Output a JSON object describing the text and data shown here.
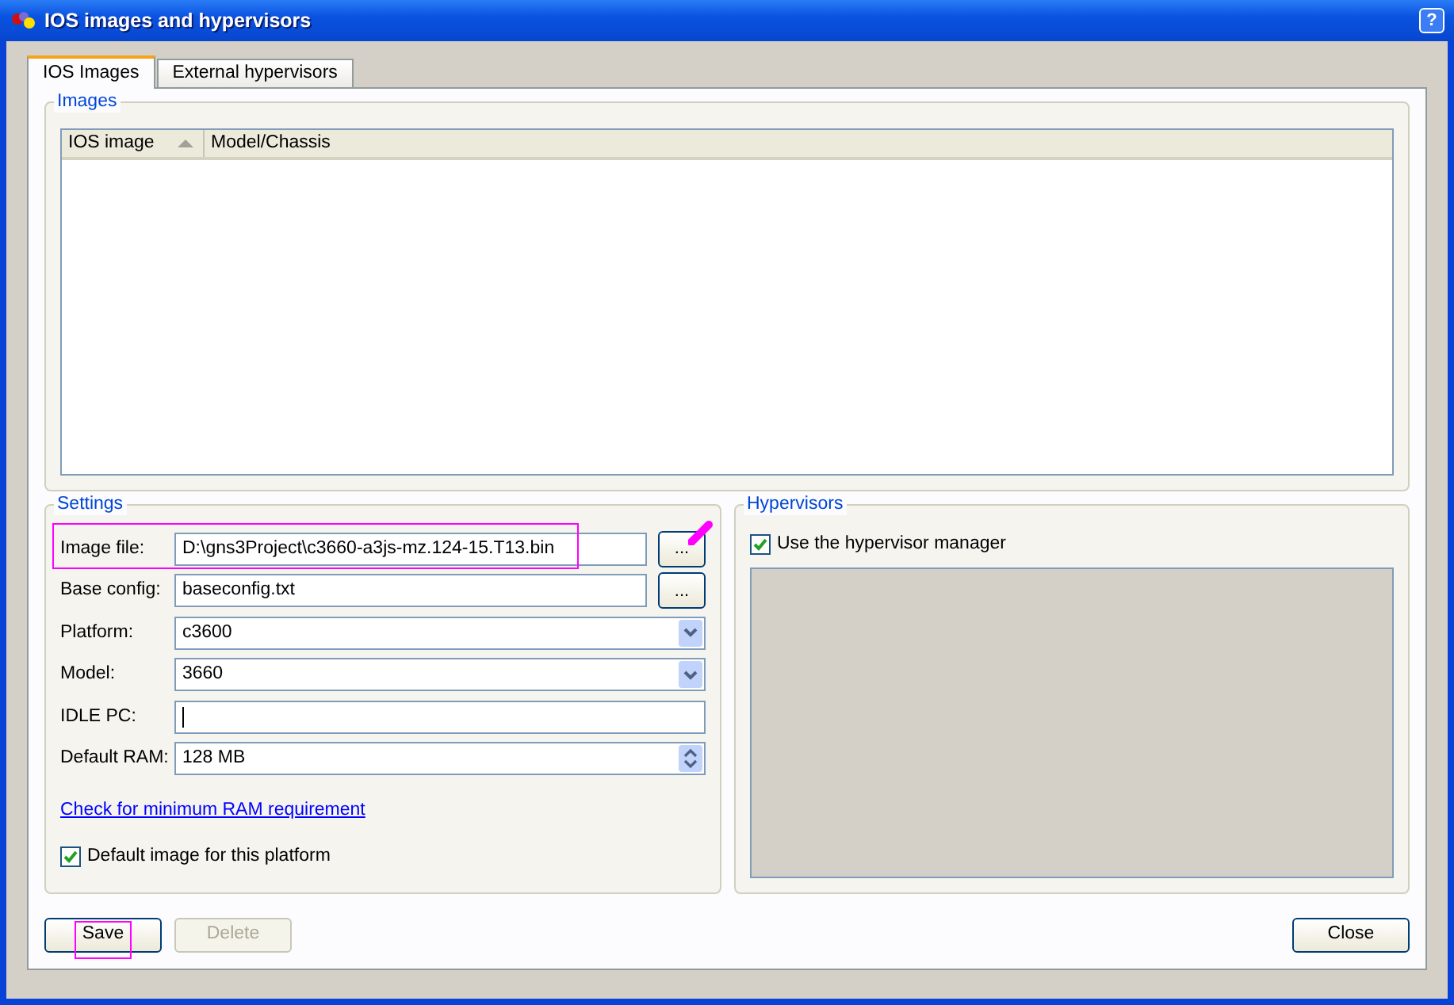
{
  "window": {
    "title": "IOS images and hypervisors",
    "help_button": "?"
  },
  "tabs": [
    {
      "label": "IOS Images",
      "selected": true
    },
    {
      "label": "External hypervisors",
      "selected": false
    }
  ],
  "images": {
    "title": "Images",
    "columns": [
      {
        "label": "IOS image",
        "sorted": true
      },
      {
        "label": "Model/Chassis",
        "sorted": false
      }
    ]
  },
  "settings": {
    "title": "Settings",
    "fields": [
      {
        "kind": "browse",
        "label": "Image file:",
        "value": "D:\\gns3Project\\c3660-a3js-mz.124-15.T13.bin",
        "button": "...",
        "highlighted": true,
        "pen_mark": true
      },
      {
        "kind": "browse",
        "label": "Base config:",
        "value": "baseconfig.txt",
        "button": "...",
        "highlighted": false,
        "pen_mark": false
      },
      {
        "kind": "select",
        "label": "Platform:",
        "value": "c3600"
      },
      {
        "kind": "select",
        "label": "Model:",
        "value": "3660"
      },
      {
        "kind": "text",
        "label": "IDLE PC:",
        "focused": true
      },
      {
        "kind": "spin",
        "label": "Default RAM:",
        "value": "128 MB"
      }
    ],
    "link": "Check for minimum RAM requirement",
    "default_checkbox": {
      "label": "Default image for this platform",
      "checked": true
    }
  },
  "hypervisors": {
    "title": "Hypervisors",
    "checkbox": {
      "label": "Use the hypervisor manager",
      "checked": true
    }
  },
  "buttons": [
    {
      "label": "Save",
      "disabled": false,
      "highlighted": true
    },
    {
      "label": "Delete",
      "disabled": true,
      "highlighted": false
    },
    {
      "label": "Close",
      "disabled": false,
      "highlighted": false
    }
  ]
}
